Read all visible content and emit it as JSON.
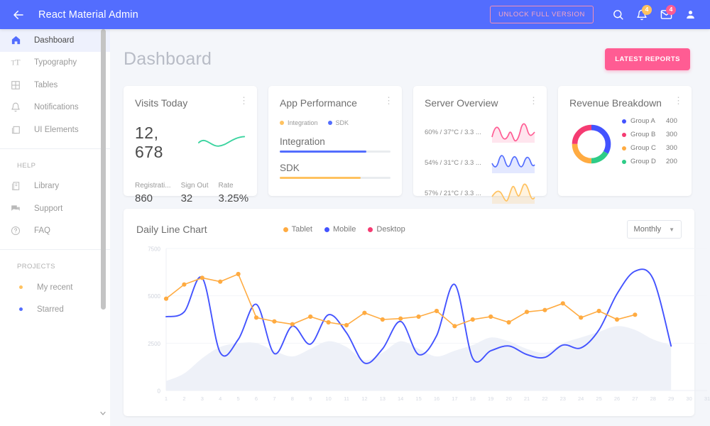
{
  "header": {
    "back_icon": "arrow-left-icon",
    "title": "React Material Admin",
    "unlock_label": "UNLOCK FULL VERSION",
    "search_icon": "search-icon",
    "notifications_icon": "bell-icon",
    "notifications_badge": "4",
    "mail_icon": "mail-icon",
    "mail_badge": "4",
    "account_icon": "person-icon",
    "bg_color": "#536dfe"
  },
  "sidebar": {
    "items": [
      {
        "label": "Dashboard",
        "icon": "home-icon",
        "active": true
      },
      {
        "label": "Typography",
        "icon": "typography-icon",
        "active": false
      },
      {
        "label": "Tables",
        "icon": "table-icon",
        "active": false
      },
      {
        "label": "Notifications",
        "icon": "bell-icon",
        "active": false
      },
      {
        "label": "UI Elements",
        "icon": "layers-icon",
        "active": false
      }
    ],
    "help_title": "HELP",
    "help_items": [
      {
        "label": "Library",
        "icon": "library-icon"
      },
      {
        "label": "Support",
        "icon": "chat-icon"
      },
      {
        "label": "FAQ",
        "icon": "question-icon"
      }
    ],
    "projects_title": "PROJECTS",
    "projects": [
      {
        "label": "My recent",
        "color": "#ffc260"
      },
      {
        "label": "Starred",
        "color": "#536dfe"
      }
    ],
    "scroll_down_icon": "chevron-down-icon"
  },
  "main": {
    "page_title": "Dashboard",
    "reports_button": "LATEST REPORTS",
    "reports_color": "#ff5c93"
  },
  "cards": {
    "visits": {
      "title": "Visits Today",
      "menu_icon": "more-vertical-icon",
      "value": "12, 678",
      "sparkline_color": "#3cd4a0",
      "stats": [
        {
          "label": "Registrati...",
          "value": "860"
        },
        {
          "label": "Sign Out",
          "value": "32"
        },
        {
          "label": "Rate",
          "value": "3.25%"
        }
      ]
    },
    "performance": {
      "title": "App Performance",
      "menu_icon": "more-vertical-icon",
      "legend": [
        {
          "label": "Integration",
          "color": "#ffc260"
        },
        {
          "label": "SDK",
          "color": "#536dfe"
        }
      ],
      "bars": [
        {
          "name": "Integration",
          "percent": 78,
          "color": "#536dfe"
        },
        {
          "name": "SDK",
          "percent": 73,
          "color": "#ffc260"
        }
      ]
    },
    "server": {
      "title": "Server Overview",
      "menu_icon": "more-vertical-icon",
      "rows": [
        {
          "text": "60% / 37°C / 3.3 ...",
          "color": "#ff5c93"
        },
        {
          "text": "54% / 31°C / 3.3 ...",
          "color": "#536dfe"
        },
        {
          "text": "57% / 21°C / 3.3 ...",
          "color": "#ffc260"
        }
      ]
    },
    "revenue": {
      "title": "Revenue Breakdown",
      "menu_icon": "more-vertical-icon",
      "legend": [
        {
          "label": "Group A",
          "value": "400",
          "color": "#4353ff"
        },
        {
          "label": "Group B",
          "value": "300",
          "color": "#f53b72"
        },
        {
          "label": "Group C",
          "value": "300",
          "color": "#ffab41"
        },
        {
          "label": "Group D",
          "value": "200",
          "color": "#2ecc87"
        }
      ]
    }
  },
  "chart_data": {
    "type": "line",
    "title": "Daily Line Chart",
    "xlabel": "",
    "ylabel": "",
    "grid": true,
    "legend_position": "top-center",
    "period_label": "Monthly",
    "period_caret_icon": "chevron-down-icon",
    "ylim": [
      0,
      7500
    ],
    "yticks": [
      0,
      2500,
      5000,
      7500
    ],
    "ytick_labels": [
      "0",
      "2500",
      "5000",
      "7500"
    ],
    "x": [
      1,
      2,
      3,
      4,
      5,
      6,
      7,
      8,
      9,
      10,
      11,
      12,
      13,
      14,
      15,
      16,
      17,
      18,
      19,
      20,
      21,
      22,
      23,
      24,
      25,
      26,
      27,
      28,
      29,
      30,
      31
    ],
    "xtick_labels": [
      "1",
      "2",
      "3",
      "4",
      "5",
      "6",
      "7",
      "8",
      "9",
      "10",
      "11",
      "12",
      "13",
      "14",
      "15",
      "16",
      "17",
      "18",
      "19",
      "20",
      "21",
      "22",
      "23",
      "24",
      "25",
      "26",
      "27",
      "28",
      "29",
      "30",
      "31"
    ],
    "series": [
      {
        "name": "Tablet",
        "color": "#ffab41",
        "markers": true,
        "values": [
          4850,
          5600,
          5950,
          5750,
          6150,
          3850,
          3650,
          3500,
          3900,
          3600,
          3450,
          4100,
          3750,
          3800,
          3900,
          4200,
          3400,
          3750,
          3900,
          3600,
          4150,
          4250,
          4600,
          3850,
          4200,
          3750,
          4000
        ]
      },
      {
        "name": "Mobile",
        "color": "#4353ff",
        "markers": false,
        "values": [
          3900,
          4150,
          5950,
          2000,
          2700,
          4550,
          1950,
          3400,
          2450,
          4000,
          3050,
          1450,
          2200,
          3650,
          1900,
          2900,
          5600,
          1700,
          2100,
          2350,
          1900,
          1750,
          2400,
          2250,
          3200,
          5100,
          6300,
          5900,
          2350
        ]
      },
      {
        "name": "Desktop",
        "color": "#f53b72",
        "area": true,
        "area_color": "#eef1f8",
        "values": [
          500,
          900,
          1700,
          2300,
          2500,
          2500,
          2100,
          1800,
          2200,
          2600,
          2300,
          1600,
          2000,
          2600,
          2200,
          1800,
          2100,
          2400,
          2800,
          2600,
          2200,
          2000,
          2500,
          2800,
          3100,
          3400,
          3200,
          2700,
          2400
        ]
      }
    ]
  }
}
